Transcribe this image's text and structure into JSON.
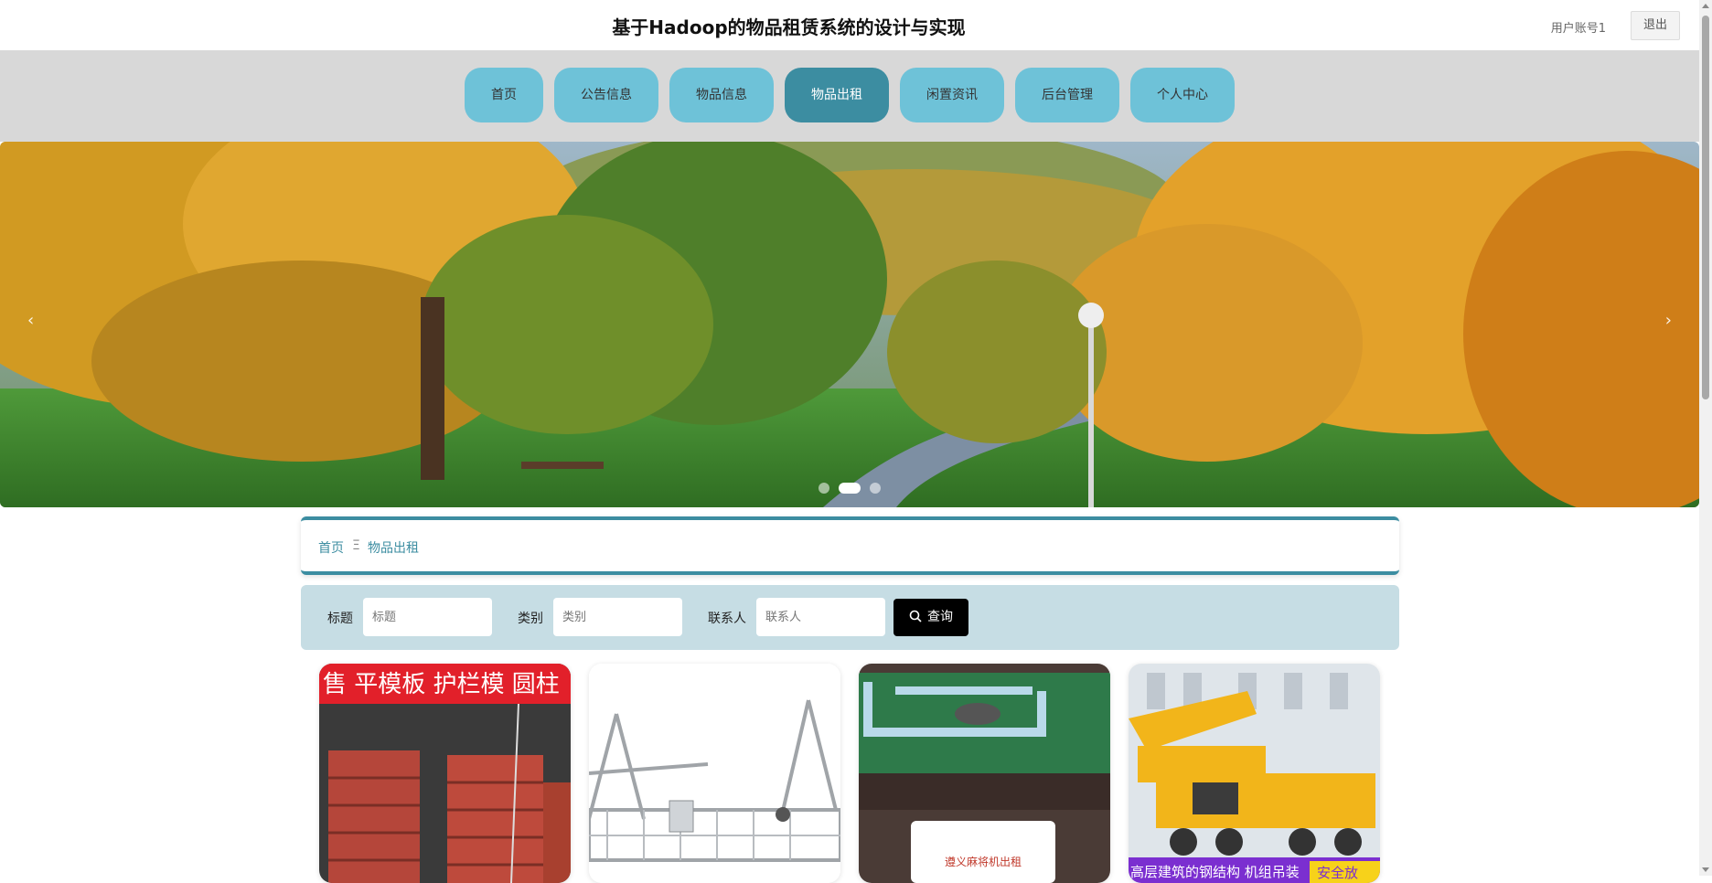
{
  "header": {
    "title": "基于Hadoop的物品租赁系统的设计与实现",
    "user_account": "用户账号1",
    "logout_label": "退出"
  },
  "nav": {
    "items": [
      {
        "label": "首页"
      },
      {
        "label": "公告信息"
      },
      {
        "label": "物品信息"
      },
      {
        "label": "物品出租",
        "active": true
      },
      {
        "label": "闲置资讯"
      },
      {
        "label": "后台管理"
      },
      {
        "label": "个人中心"
      }
    ]
  },
  "banner": {
    "prev_icon": "chevron-left-icon",
    "next_icon": "chevron-right-icon",
    "slide_count": 3,
    "active_slide": 2
  },
  "breadcrumb": {
    "home": "首页",
    "separator": "Ξ",
    "current": "物品出租"
  },
  "search": {
    "title_label": "标题",
    "title_placeholder": "标题",
    "category_label": "类别",
    "category_placeholder": "类别",
    "contact_label": "联系人",
    "contact_placeholder": "联系人",
    "button_label": "查询",
    "button_icon": "search-icon"
  },
  "cards": [
    {
      "image_text": "售 平模板 护栏模 圆柱"
    },
    {
      "image_text": ""
    },
    {
      "image_text": "遵义麻将机出租"
    },
    {
      "image_text": "高层建筑的钢结构 机组吊装",
      "image_badge": "安全放"
    }
  ],
  "colors": {
    "nav_bg": "#d8d8d8",
    "nav_item": "#6ec2d8",
    "nav_active": "#3c8da1",
    "search_bg": "#c6dde4",
    "accent": "#3c8da1"
  }
}
